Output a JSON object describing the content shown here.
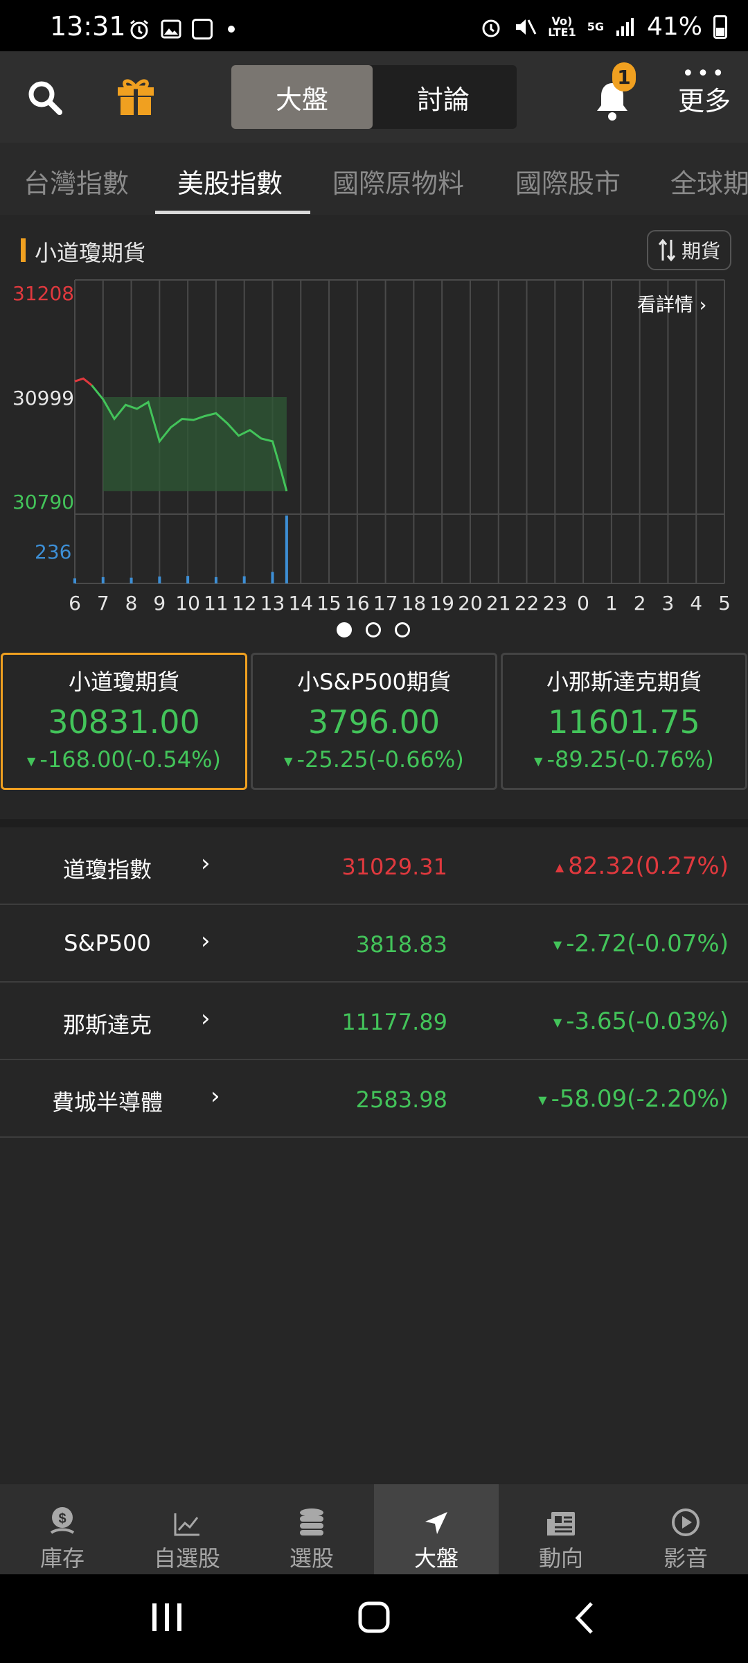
{
  "status_bar": {
    "time": "13:31",
    "network_top": "Vo)",
    "network_bottom": "LTE1",
    "network_5g": "5G",
    "battery": "41%"
  },
  "header": {
    "segments": [
      "大盤",
      "討論"
    ],
    "active_segment": "大盤",
    "notification_count": "1",
    "more_label": "更多"
  },
  "tabs": [
    "台灣指數",
    "美股指數",
    "國際原物料",
    "國際股市",
    "全球期"
  ],
  "active_tab": "美股指數",
  "chart": {
    "title": "小道瓊期貨",
    "switch_label": "期貨",
    "detail_link": "看詳情 ›"
  },
  "chart_data": {
    "type": "line",
    "series_name": "小道瓊期貨",
    "y_labels": {
      "high": "31208",
      "ref": "30999",
      "low": "30790",
      "volume_max": "236"
    },
    "ylim": [
      30790,
      31208
    ],
    "reference": 30999,
    "x_ticks": [
      "6",
      "7",
      "8",
      "9",
      "10",
      "11",
      "12",
      "13",
      "14",
      "15",
      "16",
      "17",
      "18",
      "19",
      "20",
      "21",
      "22",
      "23",
      "0",
      "1",
      "2",
      "3",
      "4",
      "5"
    ],
    "x": [
      6.0,
      6.3,
      6.6,
      7.0,
      7.4,
      7.8,
      8.2,
      8.6,
      9.0,
      9.4,
      9.8,
      10.2,
      10.6,
      11.0,
      11.4,
      11.8,
      12.2,
      12.6,
      13.0,
      13.3,
      13.5
    ],
    "y": [
      31027,
      31032,
      31020,
      30995,
      30960,
      30985,
      30978,
      30990,
      30920,
      30945,
      30960,
      30958,
      30965,
      30970,
      30952,
      30930,
      30940,
      30925,
      30920,
      30868,
      30831
    ],
    "volume_x": [
      6,
      7,
      8,
      9,
      10,
      11,
      12,
      13,
      13.5
    ],
    "volume": [
      18,
      22,
      20,
      24,
      26,
      22,
      25,
      40,
      236
    ]
  },
  "pager": {
    "count": 3,
    "active": 0
  },
  "cards": [
    {
      "name": "小道瓊期貨",
      "value": "30831.00",
      "change": "-168.00(-0.54%)"
    },
    {
      "name": "小S&P500期貨",
      "value": "3796.00",
      "change": "-25.25(-0.66%)"
    },
    {
      "name": "小那斯達克期貨",
      "value": "11601.75",
      "change": "-89.25(-0.76%)"
    }
  ],
  "indices": [
    {
      "name": "道瓊指數",
      "value": "31029.31",
      "change": "82.32(0.27%)",
      "direction": "up"
    },
    {
      "name": "S&P500",
      "value": "3818.83",
      "change": "-2.72(-0.07%)",
      "direction": "down"
    },
    {
      "name": "那斯達克",
      "value": "11177.89",
      "change": "-3.65(-0.03%)",
      "direction": "down"
    },
    {
      "name": "費城半導體",
      "value": "2583.98",
      "change": "-58.09(-2.20%)",
      "direction": "down"
    }
  ],
  "bottom_nav": [
    {
      "label": "庫存",
      "icon": "money-bag-icon"
    },
    {
      "label": "自選股",
      "icon": "line-chart-icon"
    },
    {
      "label": "選股",
      "icon": "coin-stack-icon"
    },
    {
      "label": "大盤",
      "icon": "navigation-arrow-icon"
    },
    {
      "label": "動向",
      "icon": "newspaper-icon"
    },
    {
      "label": "影音",
      "icon": "play-circle-icon"
    }
  ],
  "active_nav": "大盤",
  "colors": {
    "up": "#e0393e",
    "down": "#43c45a",
    "accent": "#f0a020",
    "volume": "#3d8fd6"
  }
}
